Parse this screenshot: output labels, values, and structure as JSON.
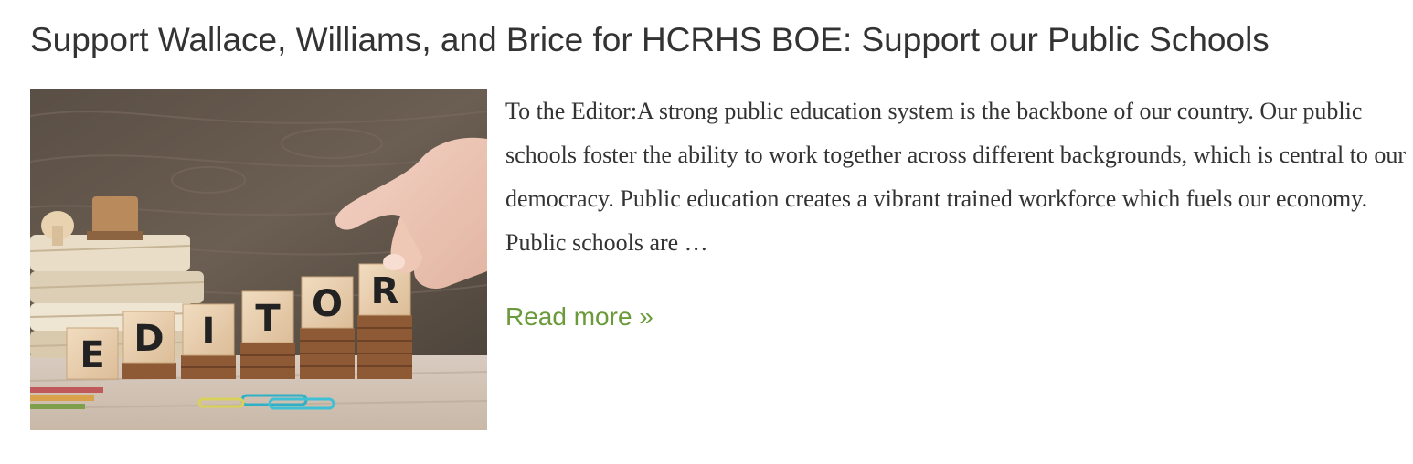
{
  "post": {
    "title": "Support Wallace, Williams, and Brice for HCRHS BOE: Support our Public Schools",
    "excerpt": "To the Editor:A strong public education system is the backbone of our country. Our public schools foster the ability to work together across different backgrounds, which is central to our democracy.  Public education creates a vibrant trained workforce which fuels our economy.  Public schools are …",
    "read_more": "Read more »",
    "thumbnail": {
      "tiles": [
        "E",
        "D",
        "I",
        "T",
        "O",
        "R"
      ]
    }
  },
  "colors": {
    "title": "#333333",
    "body_text": "#333333",
    "link_accent": "#6b9a3a"
  }
}
